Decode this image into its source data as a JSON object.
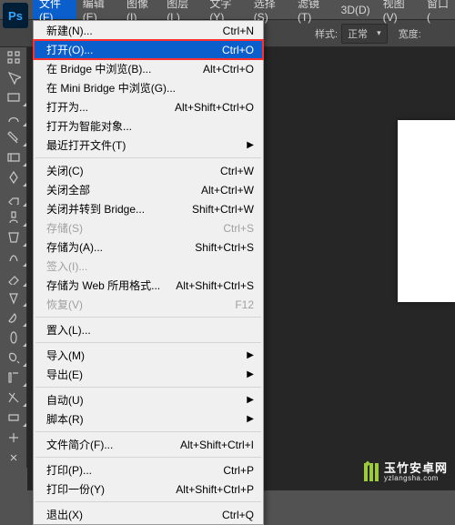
{
  "brand": "Ps",
  "menubar": [
    {
      "label": "文件(F)",
      "active": true
    },
    {
      "label": "编辑(E)"
    },
    {
      "label": "图像(I)"
    },
    {
      "label": "图层(L)"
    },
    {
      "label": "文字(Y)"
    },
    {
      "label": "选择(S)"
    },
    {
      "label": "滤镜(T)"
    },
    {
      "label": "3D(D)"
    },
    {
      "label": "视图(V)"
    },
    {
      "label": "窗口("
    }
  ],
  "options": {
    "style_label": "样式:",
    "style_value": "正常",
    "width_label": "宽度:"
  },
  "dropdown": [
    {
      "type": "item",
      "label": "新建(N)...",
      "shortcut": "Ctrl+N"
    },
    {
      "type": "item",
      "label": "打开(O)...",
      "shortcut": "Ctrl+O",
      "selected": true
    },
    {
      "type": "item",
      "label": "在 Bridge 中浏览(B)...",
      "shortcut": "Alt+Ctrl+O"
    },
    {
      "type": "item",
      "label": "在 Mini Bridge 中浏览(G)..."
    },
    {
      "type": "item",
      "label": "打开为...",
      "shortcut": "Alt+Shift+Ctrl+O"
    },
    {
      "type": "item",
      "label": "打开为智能对象..."
    },
    {
      "type": "submenu",
      "label": "最近打开文件(T)"
    },
    {
      "type": "sep"
    },
    {
      "type": "item",
      "label": "关闭(C)",
      "shortcut": "Ctrl+W"
    },
    {
      "type": "item",
      "label": "关闭全部",
      "shortcut": "Alt+Ctrl+W"
    },
    {
      "type": "item",
      "label": "关闭并转到 Bridge...",
      "shortcut": "Shift+Ctrl+W"
    },
    {
      "type": "item",
      "label": "存储(S)",
      "shortcut": "Ctrl+S",
      "disabled": true
    },
    {
      "type": "item",
      "label": "存储为(A)...",
      "shortcut": "Shift+Ctrl+S"
    },
    {
      "type": "item",
      "label": "签入(I)...",
      "disabled": true
    },
    {
      "type": "item",
      "label": "存储为 Web 所用格式...",
      "shortcut": "Alt+Shift+Ctrl+S"
    },
    {
      "type": "item",
      "label": "恢复(V)",
      "shortcut": "F12",
      "disabled": true
    },
    {
      "type": "sep"
    },
    {
      "type": "item",
      "label": "置入(L)..."
    },
    {
      "type": "sep"
    },
    {
      "type": "submenu",
      "label": "导入(M)"
    },
    {
      "type": "submenu",
      "label": "导出(E)"
    },
    {
      "type": "sep"
    },
    {
      "type": "submenu",
      "label": "自动(U)"
    },
    {
      "type": "submenu",
      "label": "脚本(R)"
    },
    {
      "type": "sep"
    },
    {
      "type": "item",
      "label": "文件简介(F)...",
      "shortcut": "Alt+Shift+Ctrl+I"
    },
    {
      "type": "sep"
    },
    {
      "type": "item",
      "label": "打印(P)...",
      "shortcut": "Ctrl+P"
    },
    {
      "type": "item",
      "label": "打印一份(Y)",
      "shortcut": "Alt+Shift+Ctrl+P"
    },
    {
      "type": "sep"
    },
    {
      "type": "item",
      "label": "退出(X)",
      "shortcut": "Ctrl+Q"
    }
  ],
  "watermark": {
    "title": "玉竹安卓网",
    "sub": "yzlangsha.com"
  }
}
